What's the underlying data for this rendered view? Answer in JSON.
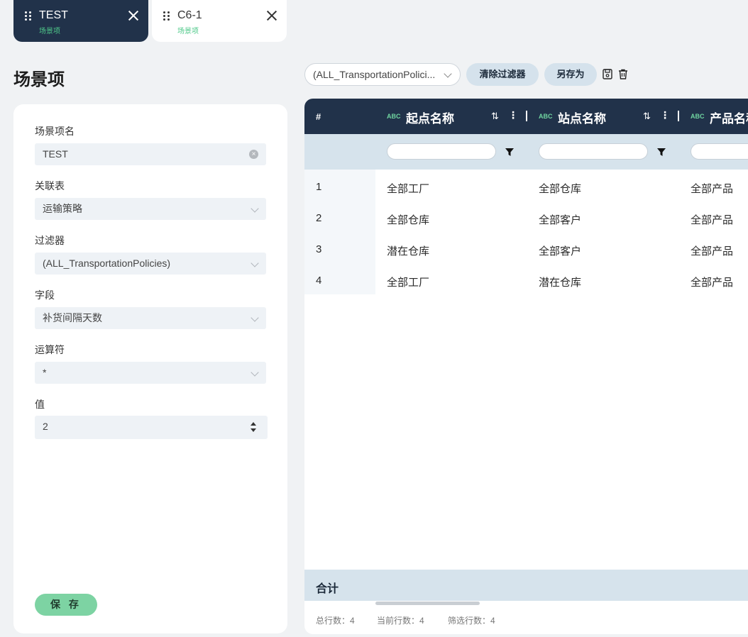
{
  "tabs": [
    {
      "title": "TEST",
      "subtitle": "场景项"
    },
    {
      "title": "C6-1",
      "subtitle": "场景项"
    }
  ],
  "page_title": "场景项",
  "form": {
    "name_label": "场景项名",
    "name_value": "TEST",
    "table_label": "关联表",
    "table_value": "运输策略",
    "filter_label": "过滤器",
    "filter_value": "(ALL_TransportationPolicies)",
    "field_label": "字段",
    "field_value": "补货间隔天数",
    "operator_label": "运算符",
    "operator_value": "*",
    "value_label": "值",
    "value_value": "2",
    "save_label": "保 存"
  },
  "toolbar": {
    "filter_select_value": "(ALL_TransportationPolici...",
    "clear_filter_label": "清除过滤器",
    "save_as_label": "另存为",
    "icons": [
      "save-icon",
      "trash-icon"
    ]
  },
  "grid": {
    "rownum_header": "#",
    "type_badge": "ABC",
    "columns": [
      "起点名称",
      "站点名称",
      "产品名称"
    ],
    "rows": [
      {
        "num": "1",
        "c1": "全部工厂",
        "c2": "全部仓库",
        "c3": "全部产品"
      },
      {
        "num": "2",
        "c1": "全部仓库",
        "c2": "全部客户",
        "c3": "全部产品"
      },
      {
        "num": "3",
        "c1": "潜在仓库",
        "c2": "全部客户",
        "c3": "全部产品"
      },
      {
        "num": "4",
        "c1": "全部工厂",
        "c2": "潜在仓库",
        "c3": "全部产品"
      }
    ],
    "total_label": "合计",
    "footer": {
      "total_rows": "总行数：4",
      "current_rows": "当前行数：4",
      "filtered_rows": "筛选行数：4"
    }
  },
  "colors": {
    "dark_navy": "#21324a",
    "accent_green": "#7dd3a3",
    "header_light": "#d6e3ec"
  }
}
